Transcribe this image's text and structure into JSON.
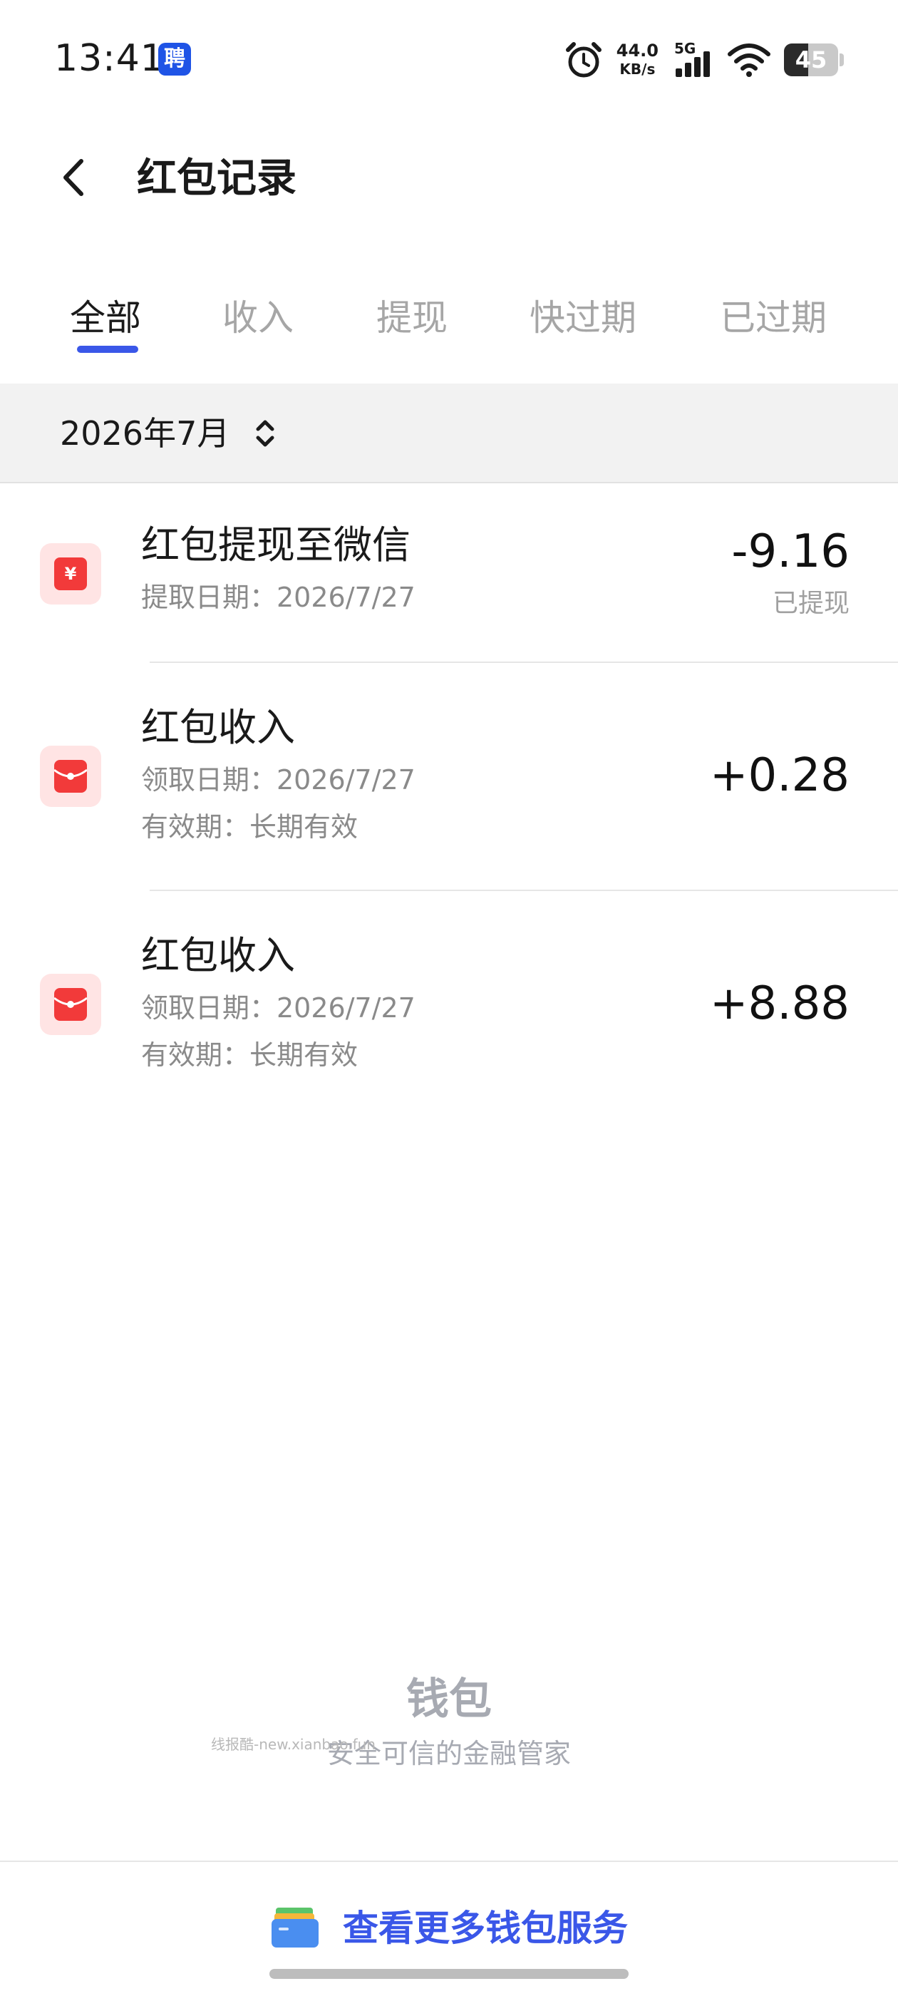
{
  "status_bar": {
    "time": "13:41",
    "app_badge": "聘",
    "net_speed": "44.0",
    "net_speed_unit": "KB/s",
    "network": "5G",
    "battery": "45",
    "battery_level": 0.45
  },
  "header": {
    "title": "红包记录"
  },
  "tabs": [
    {
      "label": "全部",
      "active": true
    },
    {
      "label": "收入",
      "active": false
    },
    {
      "label": "提现",
      "active": false
    },
    {
      "label": "快过期",
      "active": false
    },
    {
      "label": "已过期",
      "active": false
    }
  ],
  "filter": {
    "month": "2026年7月"
  },
  "records": [
    {
      "title": "红包提现至微信",
      "date_line": "提取日期：2026/7/27",
      "amount": "-9.16",
      "status": "已提现",
      "icon": "yuan-icon"
    },
    {
      "title": "红包收入",
      "date_line": "领取日期：2026/7/27",
      "validity_line": "有效期：长期有效",
      "amount": "+0.28",
      "icon": "red-envelope-icon"
    },
    {
      "title": "红包收入",
      "date_line": "领取日期：2026/7/27",
      "validity_line": "有效期：长期有效",
      "amount": "+8.88",
      "icon": "red-envelope-icon"
    }
  ],
  "footer": {
    "brand": "钱包",
    "slogan": "安全可信的金融管家",
    "watermark": "线报酷-new.xianbao.fun",
    "more_services": "查看更多钱包服务"
  },
  "colors": {
    "accent": "#3a57e8",
    "envelope_red": "#f23a3a",
    "envelope_bg": "#ffe4e4",
    "muted": "#8a8a8a"
  }
}
